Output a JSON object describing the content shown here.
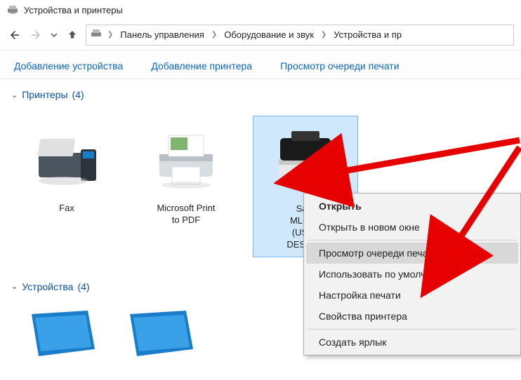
{
  "window": {
    "title": "Устройства и принтеры"
  },
  "breadcrumb": {
    "items": [
      "Панель управления",
      "Оборудование и звук",
      "Устройства и пр"
    ]
  },
  "toolbar": {
    "add_device": "Добавление устройства",
    "add_printer": "Добавление принтера",
    "view_queue": "Просмотр очереди печати"
  },
  "groups": {
    "printers": {
      "label": "Принтеры",
      "count": "(4)"
    },
    "devices": {
      "label": "Устройства",
      "count": "(4)"
    }
  },
  "printers": [
    {
      "label": "Fax"
    },
    {
      "label": "Microsoft Print\nto PDF"
    },
    {
      "label": "Sam\nML-186\n(USB0\nDESKTO"
    }
  ],
  "context_menu": {
    "open": "Открыть",
    "open_new": "Открыть в новом окне",
    "view_queue": "Просмотр очереди печати",
    "set_default": "Использовать по умолчанию",
    "print_settings": "Настройка печати",
    "printer_props": "Свойства принтера",
    "create_shortcut": "Создать ярлык"
  }
}
